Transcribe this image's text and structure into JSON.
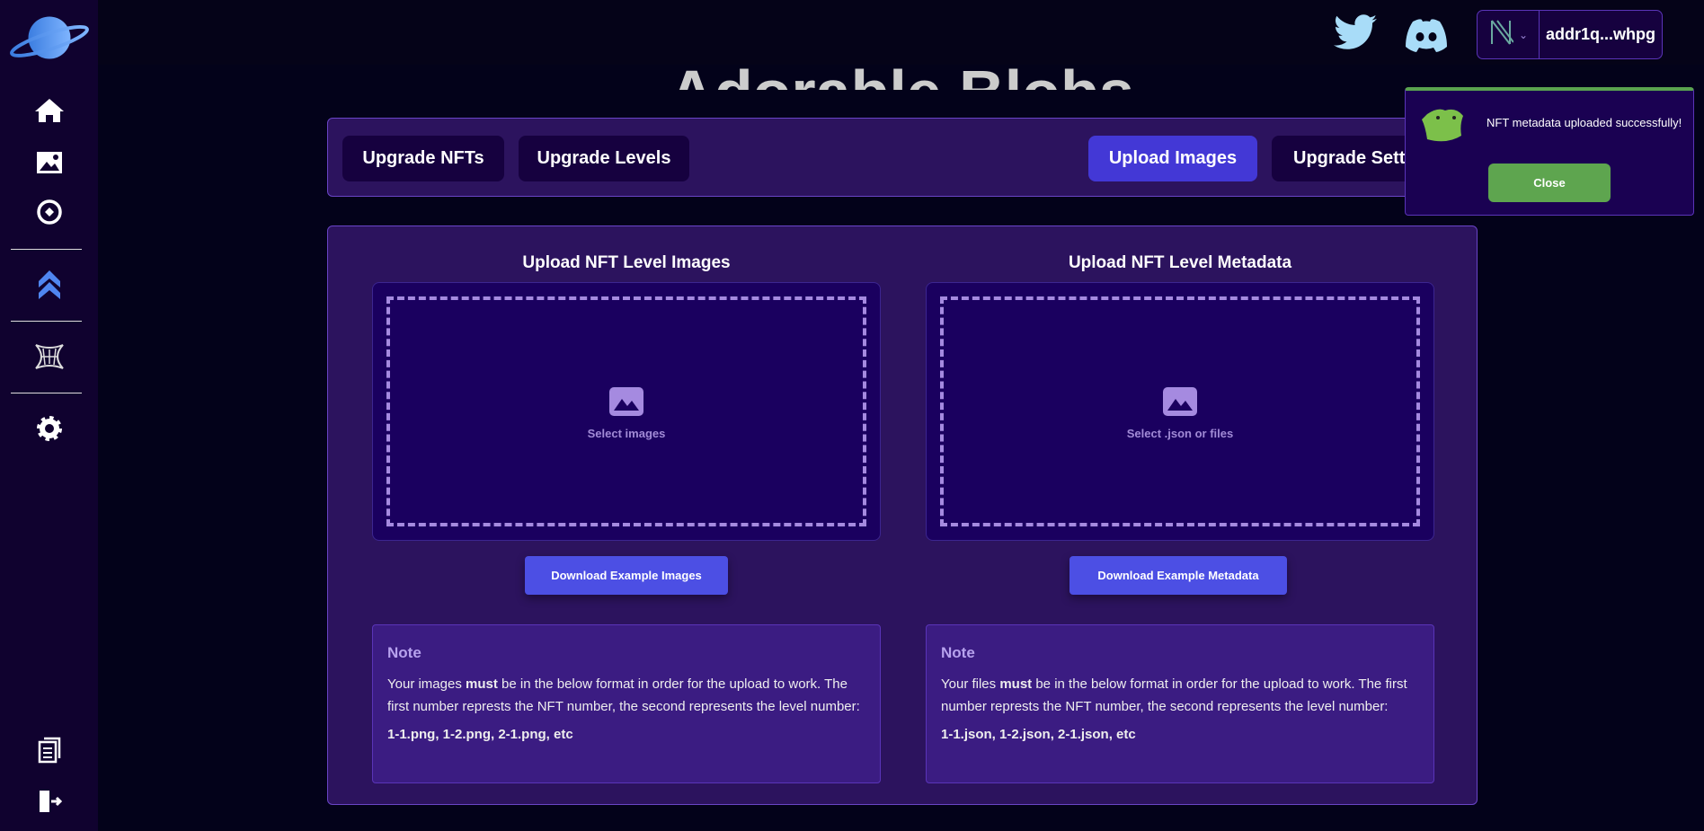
{
  "header": {
    "title": "Adorable Blobs",
    "wallet_address": "addr1q...whpg"
  },
  "tabs": [
    {
      "label": "Upgrade NFTs"
    },
    {
      "label": "Upgrade Levels"
    },
    {
      "label": "Upload Images",
      "active": true
    },
    {
      "label": "Upgrade Settings"
    }
  ],
  "images": {
    "heading": "Upload NFT Level Images",
    "drop_label": "Select images",
    "download_label": "Download Example Images",
    "note": {
      "title": "Note",
      "text_before": "Your images ",
      "text_bold": "must",
      "text_after": " be in the below format in order for the upload to work. The first number represts the NFT number, the second represents the level number:",
      "example": "1-1.png, 1-2.png, 2-1.png, etc"
    }
  },
  "metadata": {
    "heading": "Upload NFT Level Metadata",
    "drop_label": "Select .json or files",
    "download_label": "Download Example Metadata",
    "note": {
      "title": "Note",
      "text_before": "Your files ",
      "text_bold": "must",
      "text_after": " be in the below format in order for the upload to work. The first number represts the NFT number, the second represents the level number:",
      "example": "1-1.json, 1-2.json, 2-1.json, etc"
    }
  },
  "toast": {
    "message": "NFT metadata uploaded successfully!",
    "close_label": "Close",
    "accent": "#5aa34f"
  },
  "colors": {
    "accent": "#4338d6",
    "panel": "#2c135e",
    "sidebar": "#10022f"
  }
}
